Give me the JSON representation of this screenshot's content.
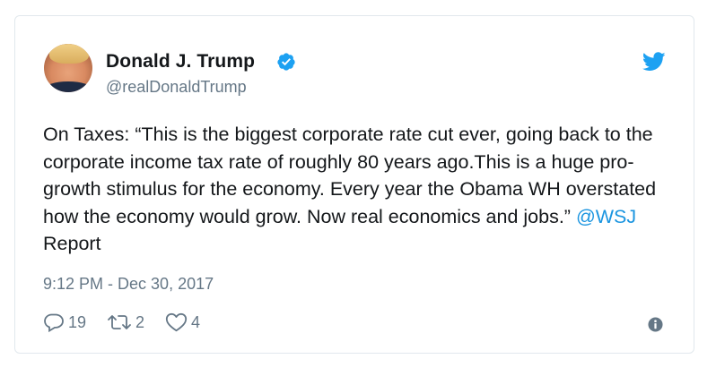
{
  "tweet": {
    "author_name": "Donald J. Trump",
    "handle": "@realDonaldTrump",
    "text_before_mention": "On Taxes: “This is the biggest corporate rate cut ever, going back to the corporate income tax rate of roughly 80 years ago.This is a huge pro-growth stimulus for the economy. Every year the Obama WH overstated how the economy would grow. Now real economics and jobs.” ",
    "mention": "@WSJ",
    "text_after_mention": " Report",
    "timestamp": "9:12 PM - Dec 30, 2017",
    "replies": "19",
    "retweets": "2",
    "likes": "4"
  },
  "icons": {
    "verified": "verified-badge-icon",
    "twitter": "twitter-bird-icon",
    "reply": "reply-icon",
    "retweet": "retweet-icon",
    "like": "heart-icon",
    "info": "info-icon"
  },
  "colors": {
    "accent": "#1da1f2",
    "mention": "#1b95e0",
    "text": "#14171a",
    "secondary": "#657786",
    "border": "#e1e8ed"
  }
}
